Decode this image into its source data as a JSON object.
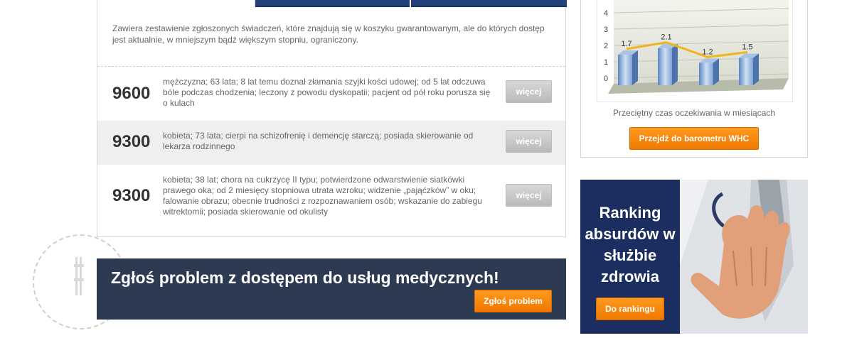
{
  "intro": "Zawiera zestawienie zgłoszonych świadczeń, które znajdują się w koszyku gwarantowanym, ale do których dostęp jest aktualnie, w mniejszym bądź większym stopniu, ograniczony.",
  "cases": [
    {
      "number": "9600",
      "description": "mężczyzna; 63 lata; 8 lat temu doznał złamania szyjki kości udowej; od 5 lat odczuwa bóle podczas chodzenia; leczony z powodu dyskopatii; pacjent od pół roku porusza się o kulach",
      "button": "więcej"
    },
    {
      "number": "9300",
      "description": "kobieta; 73 lata; cierpi na schizofrenię i demencję starczą; posiada skierowanie od lekarza rodzinnego",
      "button": "więcej"
    },
    {
      "number": "9300",
      "description": "kobieta; 38 lat; chora na cukrzycę II typu; potwierdzone odwarstwienie siatkówki prawego oka; od 2 miesięcy stopniowa utrata wzroku; widzenie „pająćzków” w oku; falowanie obrazu; obecnie trudności z rozpoznawaniem osób; wskazanie do zabiegu witrektomii; posiada skierowanie od okulisty",
      "button": "więcej"
    }
  ],
  "report": {
    "title": "Zgłoś problem z dostępem do usług medycznych!",
    "button": "Zgłoś problem"
  },
  "chart_box": {
    "caption": "Przeciętny czas oczekiwania w miesiącach",
    "button": "Przejdź do barometru WHC"
  },
  "ranking": {
    "title": "Ranking absurdów w służbie zdrowia",
    "button": "Do rankingu"
  },
  "colors": {
    "navy": "#23427c",
    "orange": "#f58a0b",
    "banner": "#2d3b52",
    "ranking": "#1c2e60"
  },
  "chart_data": {
    "type": "bar",
    "categories": [
      "",
      "",
      "",
      ""
    ],
    "values": [
      1.7,
      2.1,
      1.2,
      1.5
    ],
    "data_labels": [
      "1.7",
      "2.1",
      "1.2",
      "1.5"
    ],
    "yticks": [
      "0",
      "1",
      "2",
      "3",
      "4"
    ],
    "ylim": [
      0,
      4.5
    ],
    "line_overlay": true,
    "title": "",
    "xlabel": "",
    "ylabel": ""
  }
}
